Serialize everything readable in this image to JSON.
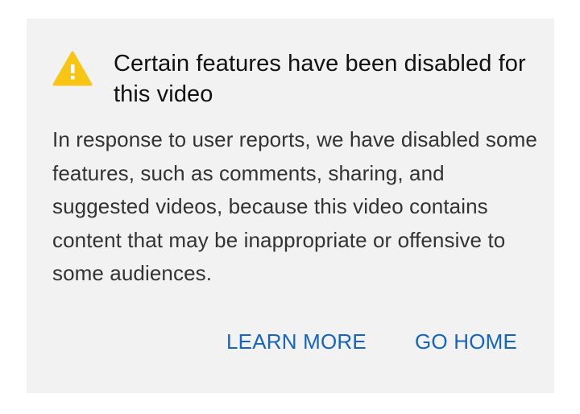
{
  "dialog": {
    "icon": "warning-triangle-icon",
    "title": "Certain features have been disabled for this video",
    "message": "In response to user reports, we have disabled some features, such as comments, sharing, and suggested videos, because this video contains content that may be inappropriate or offensive to some audiences.",
    "actions": {
      "learn_more": "LEARN MORE",
      "go_home": "GO HOME"
    }
  },
  "colors": {
    "card_background": "#f2f2f2",
    "warning_icon": "#f9c515",
    "action_text": "#1565c0",
    "title_text": "#111111",
    "body_text": "#333333"
  }
}
